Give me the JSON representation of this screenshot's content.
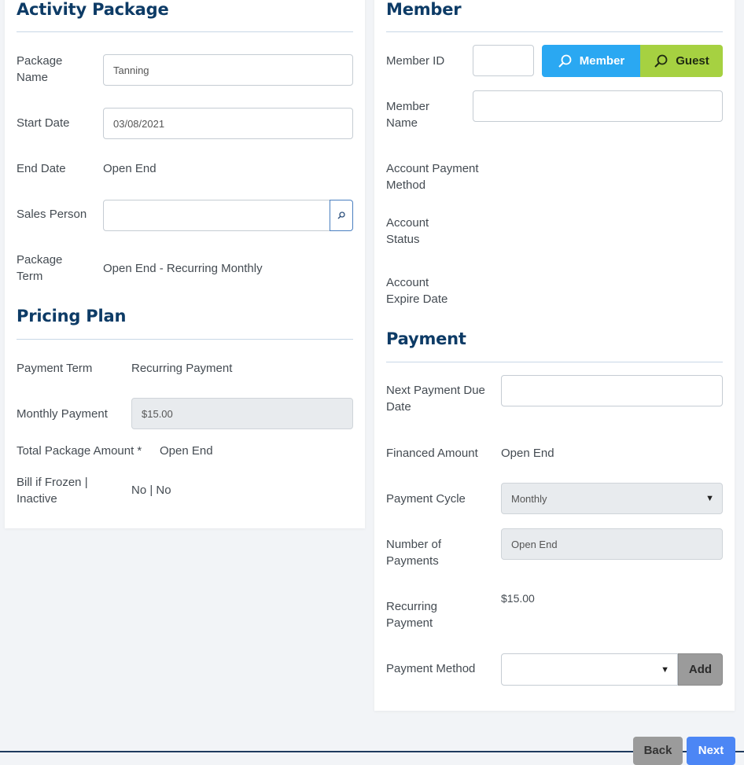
{
  "activity_package": {
    "title": "Activity Package",
    "package_name_label": "Package Name",
    "package_name_value": "Tanning",
    "start_date_label": "Start Date",
    "start_date_value": "03/08/2021",
    "end_date_label": "End Date",
    "end_date_value": "Open End",
    "sales_person_label": "Sales Person",
    "sales_person_value": "",
    "package_term_label": "Package Term",
    "package_term_value": "Open End - Recurring Monthly"
  },
  "pricing_plan": {
    "title": "Pricing Plan",
    "payment_term_label": "Payment Term",
    "payment_term_value": "Recurring Payment",
    "monthly_payment_label": "Monthly Payment",
    "monthly_payment_value": "$15.00",
    "total_package_amount_label": "Total Package Amount *",
    "total_package_amount_value": "Open End",
    "bill_if_frozen_label": "Bill if Frozen | Inactive",
    "bill_if_frozen_value": "No | No"
  },
  "member": {
    "title": "Member",
    "member_id_label": "Member ID",
    "member_id_value": "",
    "member_button_label": "Member",
    "guest_button_label": "Guest",
    "member_name_label": "Member Name",
    "member_name_value": "",
    "account_payment_method_label": "Account Payment Method",
    "account_status_label": "Account Status",
    "account_expire_date_label": "Account Expire Date"
  },
  "payment": {
    "title": "Payment",
    "next_payment_due_date_label": "Next Payment Due Date",
    "next_payment_due_date_value": "",
    "financed_amount_label": "Financed Amount",
    "financed_amount_value": "Open End",
    "payment_cycle_label": "Payment Cycle",
    "payment_cycle_value": "Monthly",
    "number_of_payments_label": "Number of Payments",
    "number_of_payments_value": "Open End",
    "recurring_payment_label": "Recurring Payment",
    "recurring_payment_value": "$15.00",
    "payment_method_label": "Payment Method",
    "payment_method_value": "",
    "add_button_label": "Add"
  },
  "footer": {
    "back_button_label": "Back",
    "next_button_label": "Next"
  },
  "colors": {
    "title": "#0d3b66",
    "member_button": "#2aa8f2",
    "guest_button": "#a6d141",
    "add_button": "#9b9b9b",
    "back_button": "#9b9b9b",
    "next_button": "#4c86f5"
  },
  "icons": {
    "search": "search-icon",
    "dropdown": "chevron-down-icon"
  }
}
